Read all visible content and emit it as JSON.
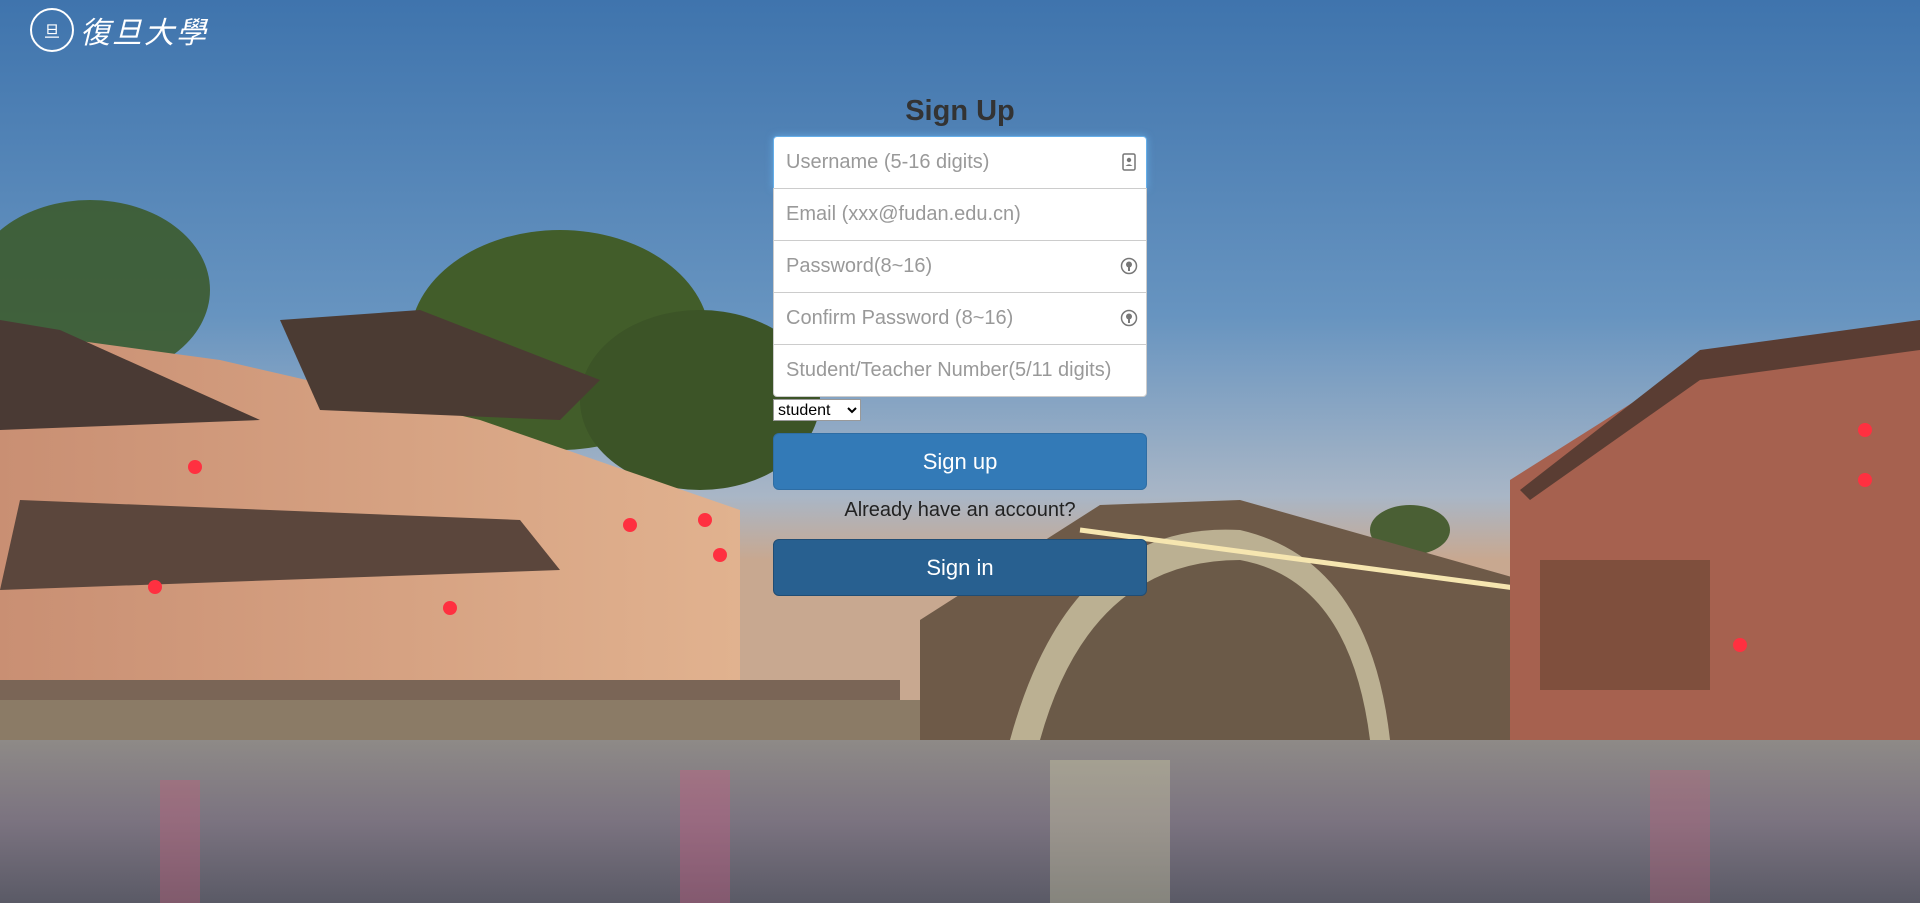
{
  "brand": {
    "seal_text": "旦",
    "name": "復旦大學"
  },
  "form": {
    "title": "Sign Up",
    "username_placeholder": "Username (5-16 digits)",
    "email_placeholder": "Email (xxx@fudan.edu.cn)",
    "password_placeholder": "Password(8~16)",
    "confirm_password_placeholder": "Confirm Password (8~16)",
    "number_placeholder": "Student/Teacher Number(5/11 digits)",
    "role_selected": "student",
    "signup_label": "Sign up",
    "already_text": "Already have an account?",
    "signin_label": "Sign in"
  },
  "colors": {
    "primary": "#337ab7",
    "primary_dark": "#286090",
    "focus": "#66afe9"
  },
  "icons": {
    "username_field": "contact-card-icon",
    "password_field": "lock-icon",
    "confirm_password_field": "lock-icon"
  }
}
